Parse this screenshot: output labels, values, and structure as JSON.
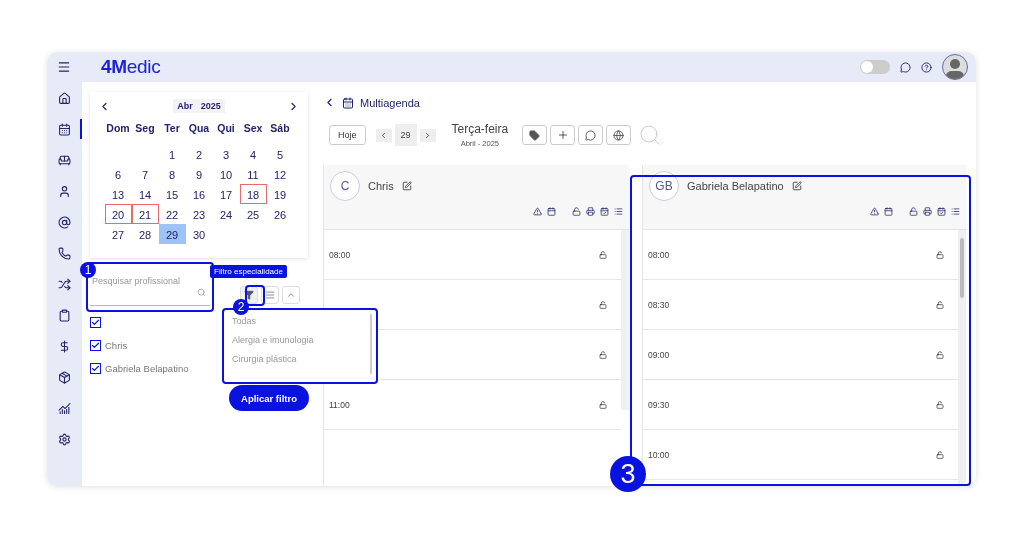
{
  "topbar": {
    "logo_bold": "4M",
    "logo_rest": "edic",
    "toggle_on": false
  },
  "sidebar": {
    "items": [
      {
        "selected": false
      },
      {
        "selected": true
      },
      {
        "selected": false
      },
      {
        "selected": false
      },
      {
        "selected": false
      },
      {
        "selected": false
      },
      {
        "selected": false
      },
      {
        "selected": false
      },
      {
        "selected": false
      },
      {
        "selected": false
      },
      {
        "selected": false
      },
      {
        "selected": false
      }
    ]
  },
  "calendar": {
    "month": "Abr",
    "year": "2025",
    "weekdays": [
      "Dom",
      "Seg",
      "Ter",
      "Qua",
      "Qui",
      "Sex",
      "Sáb"
    ],
    "weeks": [
      {
        "days": [
          {
            "label": "1",
            "selected": false,
            "marked": false
          },
          {
            "label": "2",
            "selected": false,
            "marked": false
          },
          {
            "label": "3",
            "selected": false,
            "marked": false
          },
          {
            "label": "4",
            "selected": false,
            "marked": false
          },
          {
            "label": "5",
            "selected": false,
            "marked": false
          }
        ]
      },
      {
        "days": [
          {
            "label": "6",
            "selected": false,
            "marked": false
          },
          {
            "label": "7",
            "selected": false,
            "marked": false
          },
          {
            "label": "8",
            "selected": false,
            "marked": false
          },
          {
            "label": "9",
            "selected": false,
            "marked": false
          },
          {
            "label": "10",
            "selected": false,
            "marked": false
          },
          {
            "label": "11",
            "selected": false,
            "marked": false
          },
          {
            "label": "12",
            "selected": false,
            "marked": false
          }
        ]
      },
      {
        "days": [
          {
            "label": "13",
            "selected": false,
            "marked": false
          },
          {
            "label": "14",
            "selected": false,
            "marked": false
          },
          {
            "label": "15",
            "selected": false,
            "marked": false
          },
          {
            "label": "16",
            "selected": false,
            "marked": false
          },
          {
            "label": "17",
            "selected": false,
            "marked": false
          },
          {
            "label": "18",
            "selected": false,
            "marked": true
          },
          {
            "label": "19",
            "selected": false,
            "marked": false
          }
        ]
      },
      {
        "days": [
          {
            "label": "20",
            "selected": false,
            "marked": true
          },
          {
            "label": "21",
            "selected": false,
            "marked": true
          },
          {
            "label": "22",
            "selected": false,
            "marked": false
          },
          {
            "label": "23",
            "selected": false,
            "marked": false
          },
          {
            "label": "24",
            "selected": false,
            "marked": false
          },
          {
            "label": "25",
            "selected": false,
            "marked": false
          },
          {
            "label": "26",
            "selected": false,
            "marked": false
          }
        ]
      },
      {
        "days": [
          {
            "label": "27",
            "selected": false,
            "marked": false
          },
          {
            "label": "28",
            "selected": false,
            "marked": false
          },
          {
            "label": "29",
            "selected": true,
            "marked": false
          },
          {
            "label": "30",
            "selected": false,
            "marked": false
          }
        ]
      }
    ]
  },
  "search": {
    "placeholder": "Pesquisar profissional"
  },
  "tooltip": "Filtro especialidade",
  "filter_buttons": [
    {
      "kind": "filter",
      "active": true
    },
    {
      "kind": "list",
      "active": false
    },
    {
      "kind": "collapse",
      "active": false
    }
  ],
  "specialty_menu": {
    "options": [
      "Todas",
      "Alergia e imunologia",
      "Cirurgia plástica"
    ]
  },
  "professionals": [
    {
      "checked": true
    },
    {
      "label": "Chris",
      "checked": true
    },
    {
      "label": "Gabriela Belapatino",
      "checked": true
    }
  ],
  "apply_button": "Aplicar filtro",
  "header": {
    "title": "Multiagenda"
  },
  "toolbar": {
    "today": "Hoje",
    "day": "29",
    "weekday": "Terça-feira",
    "month_year": "Abril - 2025"
  },
  "columns": [
    {
      "initials": "C",
      "name": "Chris",
      "slots": [
        {
          "time": "08:00",
          "locked": false
        },
        {
          "locked": false
        },
        {
          "locked": false
        },
        {
          "time": "11:00",
          "locked": false
        }
      ]
    },
    {
      "initials": "GB",
      "name": "Gabriela Belapatino",
      "slots": [
        {
          "time": "08:00",
          "locked": false
        },
        {
          "time": "08:30",
          "locked": false
        },
        {
          "time": "09:00",
          "locked": false
        },
        {
          "time": "09:30",
          "locked": false
        },
        {
          "time": "10:00",
          "locked": false
        }
      ]
    }
  ],
  "annotations": [
    {
      "label": "1"
    },
    {
      "label": "2"
    },
    {
      "label": "3"
    }
  ]
}
